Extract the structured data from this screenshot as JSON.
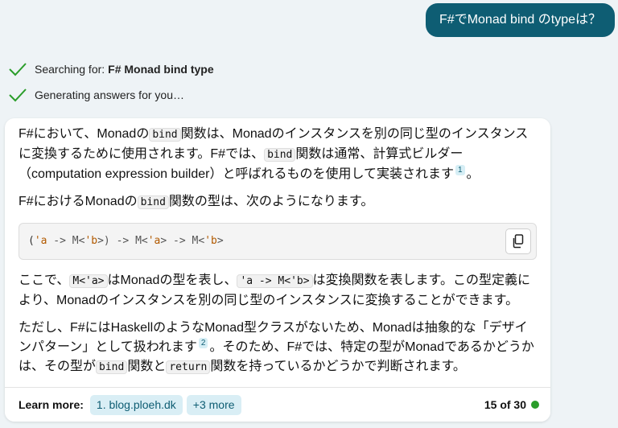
{
  "user_message": "F#でMonad bind のtypeは？",
  "status": {
    "search_prefix": "Searching for:",
    "search_query": "F# Monad bind type",
    "generating": "Generating answers for you…"
  },
  "answer": {
    "p1": {
      "a": "F#において、Monadの",
      "code1": "bind",
      "b": "関数は、Monadのインスタンスを別の同じ型のインスタンスに変換するために使用されます。F#では、",
      "code2": "bind",
      "c": "関数は通常、計算式ビルダー（computation expression builder）と呼ばれるものを使用して実装されます",
      "cite": "1",
      "d": "。"
    },
    "p2": {
      "a": "F#におけるMonadの",
      "code": "bind",
      "b": "関数の型は、次のようになります。"
    },
    "code_block": {
      "t1": "(",
      "t2": "'a",
      "t3": " -> M<",
      "t4": "'b",
      "t5": ">) -> M<",
      "t6": "'a",
      "t7": "> -> M<",
      "t8": "'b",
      "t9": ">"
    },
    "p3": {
      "a": "ここで、",
      "code1": "M<'a>",
      "b": "はMonadの型を表し、",
      "code2": "'a -> M<'b>",
      "c": "は変換関数を表します。この型定義により、Monadのインスタンスを別の同じ型のインスタンスに変換することができます。"
    },
    "p4": {
      "a": "ただし、F#にはHaskellのようなMonad型クラスがないため、Monadは抽象的な「デザインパターン」として扱われます",
      "cite": "2",
      "b": "。そのため、F#では、特定の型がMonadであるかどうかは、その型が",
      "code1": "bind",
      "c": "関数と",
      "code2": "return",
      "d": "関数を持っているかどうかで判断されます。"
    }
  },
  "footer": {
    "learn_more": "Learn more:",
    "link1": "1. blog.ploeh.dk",
    "more": "+3 more",
    "turns": "15 of 30"
  },
  "icons": {
    "status": "checkmark-icon",
    "copy": "copy-icon",
    "indicator": "status-dot"
  },
  "colors": {
    "accent": "#0e5d73",
    "check": "#2a9d2a",
    "chip_bg": "#d9eef5"
  }
}
